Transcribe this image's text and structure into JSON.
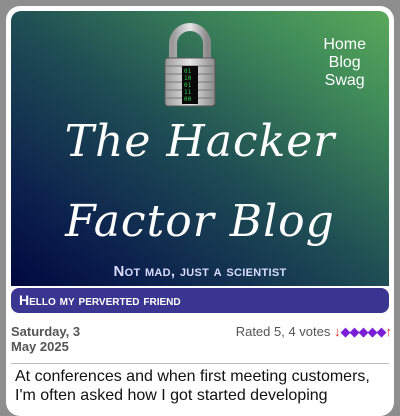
{
  "nav": {
    "home": "Home",
    "blog": "Blog",
    "swag": "Swag"
  },
  "site": {
    "title_line1": "The Hacker",
    "title_line2": "Factor Blog",
    "subtitle": "Not mad, just a scientist"
  },
  "post": {
    "title": "Hello my perverted friend",
    "date_line1": "Saturday, 3",
    "date_line2": "May 2025",
    "rating_text": "Rated 5, 4 votes",
    "rating_down": "↓",
    "rating_diamonds": "◆◆◆◆◆",
    "rating_up": "↑",
    "body": "At conferences and when first meeting customers, I'm often asked how I got started developing"
  },
  "colors": {
    "post_header_bg": "#3a3590",
    "rating_diamonds": "#7a1fd6",
    "rating_arrows": "#e0202a"
  },
  "icons": {
    "logo": "padlock-icon"
  }
}
